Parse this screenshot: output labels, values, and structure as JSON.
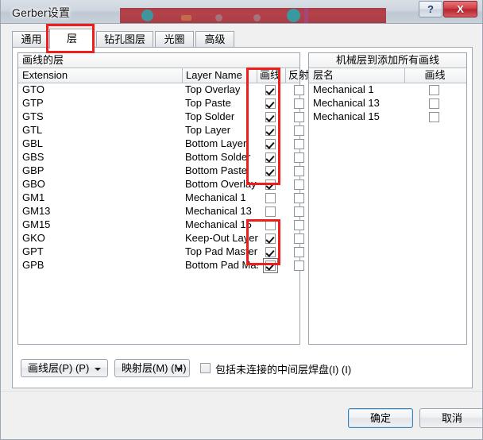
{
  "window": {
    "title": "Gerber设置",
    "help_button": "?",
    "close_button": "X"
  },
  "tabs": [
    {
      "label": "通用",
      "selected": false
    },
    {
      "label": "层",
      "selected": true
    },
    {
      "label": "钻孔图层",
      "selected": false
    },
    {
      "label": "光圈",
      "selected": false
    },
    {
      "label": "高级",
      "selected": false
    }
  ],
  "draw_layers_group": {
    "caption": "画线的层",
    "columns": [
      "Extension",
      "Layer Name",
      "画线",
      "反射"
    ],
    "rows": [
      {
        "extension": "GTO",
        "layer_name": "Top Overlay",
        "plot": true,
        "mirror": false
      },
      {
        "extension": "GTP",
        "layer_name": "Top Paste",
        "plot": true,
        "mirror": false
      },
      {
        "extension": "GTS",
        "layer_name": "Top Solder",
        "plot": true,
        "mirror": false
      },
      {
        "extension": "GTL",
        "layer_name": "Top Layer",
        "plot": true,
        "mirror": false
      },
      {
        "extension": "GBL",
        "layer_name": "Bottom Layer",
        "plot": true,
        "mirror": false
      },
      {
        "extension": "GBS",
        "layer_name": "Bottom Solder",
        "plot": true,
        "mirror": false
      },
      {
        "extension": "GBP",
        "layer_name": "Bottom Paste",
        "plot": true,
        "mirror": false
      },
      {
        "extension": "GBO",
        "layer_name": "Bottom Overlay",
        "plot": true,
        "mirror": false
      },
      {
        "extension": "GM1",
        "layer_name": "Mechanical 1",
        "plot": false,
        "mirror": false
      },
      {
        "extension": "GM13",
        "layer_name": "Mechanical 13",
        "plot": false,
        "mirror": false
      },
      {
        "extension": "GM15",
        "layer_name": "Mechanical 15",
        "plot": false,
        "mirror": false
      },
      {
        "extension": "GKO",
        "layer_name": "Keep-Out Layer",
        "plot": true,
        "mirror": false
      },
      {
        "extension": "GPT",
        "layer_name": "Top Pad Master",
        "plot": true,
        "mirror": false
      },
      {
        "extension": "GPB",
        "layer_name": "Bottom Pad Mas",
        "plot": true,
        "mirror": false,
        "focused": true
      }
    ]
  },
  "mechanical_group": {
    "caption": "机械层到添加所有画线",
    "columns": [
      "层名",
      "画线"
    ],
    "rows": [
      {
        "layer_name": "Mechanical 1",
        "plot": false
      },
      {
        "layer_name": "Mechanical 13",
        "plot": false
      },
      {
        "layer_name": "Mechanical 15",
        "plot": false
      }
    ]
  },
  "bottom_controls": {
    "draw_layers_button": "画线层(P) (P)",
    "map_layers_button": "映射层(M) (M)",
    "include_unconnected_checkbox": {
      "label": "包括未连接的中间层焊盘(I) (I)",
      "checked": false
    }
  },
  "dialog_buttons": {
    "ok": "确定",
    "cancel": "取消"
  },
  "colors": {
    "annotation": "#f01d1d",
    "focus_border": "#3c7fb1",
    "close_button": "#b4252d"
  }
}
